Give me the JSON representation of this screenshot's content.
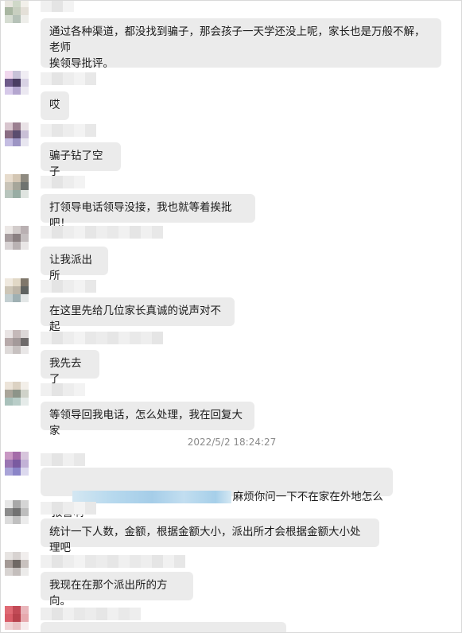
{
  "timestamp": "2022/5/2 18:24:27",
  "messages": [
    {
      "text": "通过各种渠道，都没找到骗子，那会孩子一天学还没上呢，家长也是万般不解，老师\n挨领导批评。"
    },
    {
      "text": "哎"
    },
    {
      "text": "骗子钻了空子"
    },
    {
      "text": "打领导电话领导没接，我也就等着挨批吧！"
    },
    {
      "text": "让我派出所"
    },
    {
      "text": "在这里先给几位家长真诚的说声对不起"
    },
    {
      "text": "我先去了"
    },
    {
      "text": "等领导回我电话，怎么处理，我在回复大家"
    },
    {
      "text": "麻烦你问一下不在家在外地怎么报警啊"
    },
    {
      "text": "统计一下人数，金额，根据金额大小，派出所才会根据金额大小处理吧"
    },
    {
      "text": "我现在在那个派出所的方向。"
    }
  ]
}
